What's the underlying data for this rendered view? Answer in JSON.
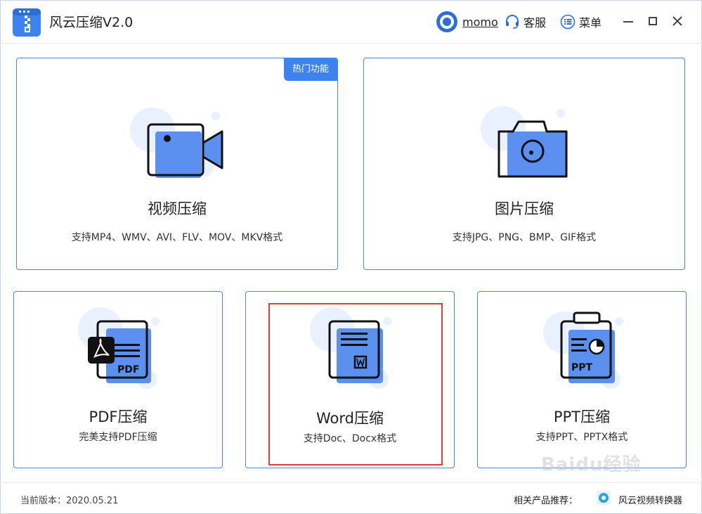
{
  "app": {
    "title": "风云压缩V2.0",
    "accent": "#3d82ef"
  },
  "user": {
    "name": "momo"
  },
  "toolbar": {
    "service_label": "客服",
    "menu_label": "菜单"
  },
  "cards": {
    "video": {
      "title": "视频压缩",
      "desc": "支持MP4、WMV、AVI、FLV、MOV、MKV格式",
      "badge": "热门功能",
      "icon": "video-camera-icon"
    },
    "image": {
      "title": "图片压缩",
      "desc": "支持JPG、PNG、BMP、GIF格式",
      "icon": "camera-icon"
    },
    "pdf": {
      "title": "PDF压缩",
      "desc": "完美支持PDF压缩",
      "icon": "pdf-file-icon",
      "icon_text": "PDF"
    },
    "word": {
      "title": "Word压缩",
      "desc": "支持Doc、Docx格式",
      "icon": "word-file-icon"
    },
    "ppt": {
      "title": "PPT压缩",
      "desc": "支持PPT、PPTX格式",
      "icon": "ppt-file-icon",
      "icon_text": "PPT"
    }
  },
  "footer": {
    "version_label": "当前版本：2020.05.21",
    "related_label": "相关产品推荐：",
    "related_product": "风云视频转换器"
  },
  "watermark": "Baidu经验"
}
